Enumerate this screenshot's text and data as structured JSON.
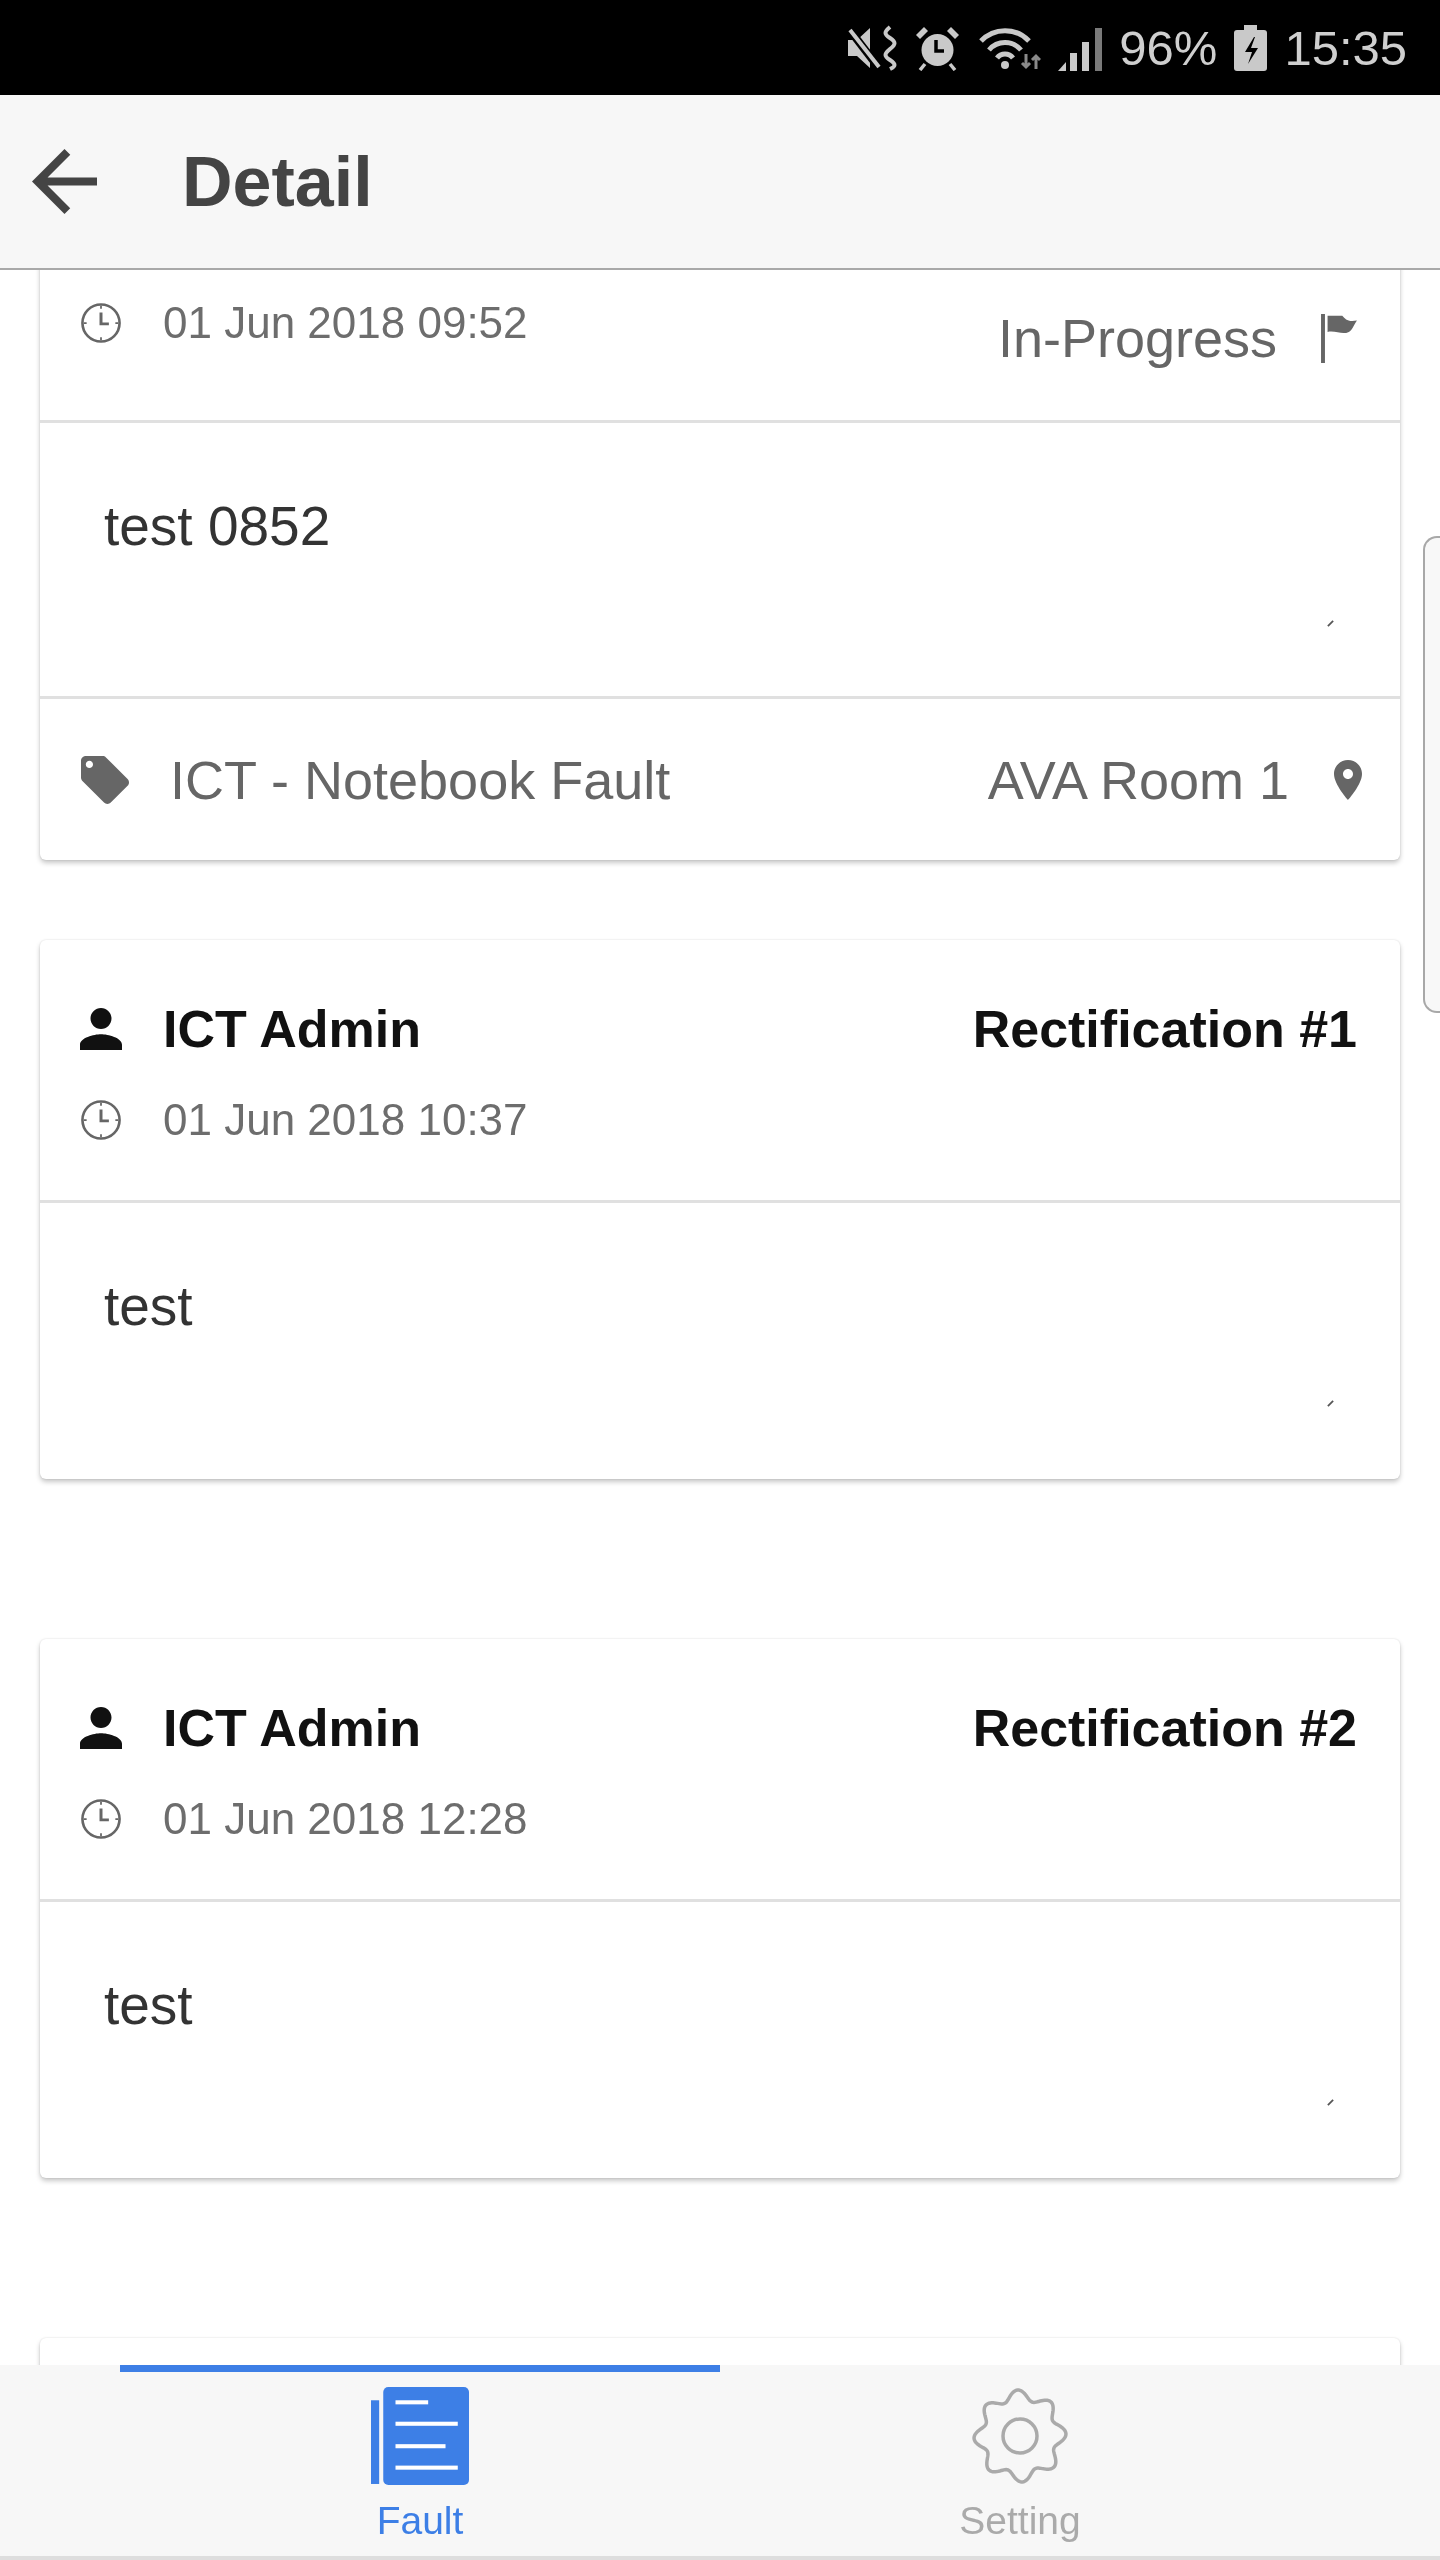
{
  "status_bar": {
    "battery": "96%",
    "time": "15:35"
  },
  "app_bar": {
    "title": "Detail"
  },
  "fault_card": {
    "date": "01 Jun 2018 09:52",
    "status": "In-Progress",
    "description": "test 0852",
    "category": "ICT - Notebook Fault",
    "location": "AVA Room 1"
  },
  "rectifications": [
    {
      "author": "ICT Admin",
      "title": "Rectification #1",
      "date": "01 Jun 2018 10:37",
      "note": "test"
    },
    {
      "author": "ICT Admin",
      "title": "Rectification #2",
      "date": "01 Jun 2018 12:28",
      "note": "test"
    }
  ],
  "bottom_nav": {
    "tabs": [
      {
        "label": "Fault",
        "selected": true
      },
      {
        "label": "Setting",
        "selected": false
      }
    ]
  }
}
